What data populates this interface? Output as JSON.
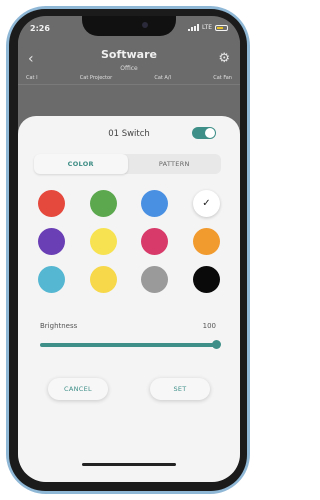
{
  "status": {
    "time": "2:26",
    "network": "LTE"
  },
  "header": {
    "title": "Software",
    "subtitle": "Office",
    "categories": [
      "Cat I",
      "Cat Projector",
      "Cat A/I",
      "Cat Fan"
    ]
  },
  "sheet": {
    "switch_name": "01 Switch",
    "switch_on": true,
    "tabs": [
      {
        "label": "COLOR",
        "active": true
      },
      {
        "label": "PATTERN",
        "active": false
      }
    ],
    "colors": [
      "#e5493d",
      "#5ba84f",
      "#4a90e2",
      "#ffffff",
      "#6a3fb5",
      "#f7e351",
      "#d83a6a",
      "#f19a2e",
      "#56b7d2",
      "#f6d84a",
      "#9a9a9a",
      "#0a0a0a"
    ],
    "selected_color_index": 3,
    "check_glyph": "✓",
    "brightness_label": "Brightness",
    "brightness_value": "100",
    "brightness_fraction": 1.0,
    "cancel_label": "CANCEL",
    "set_label": "SET"
  },
  "icons": {
    "back": "‹",
    "settings": "⚙"
  },
  "accent": "#3e8f88"
}
